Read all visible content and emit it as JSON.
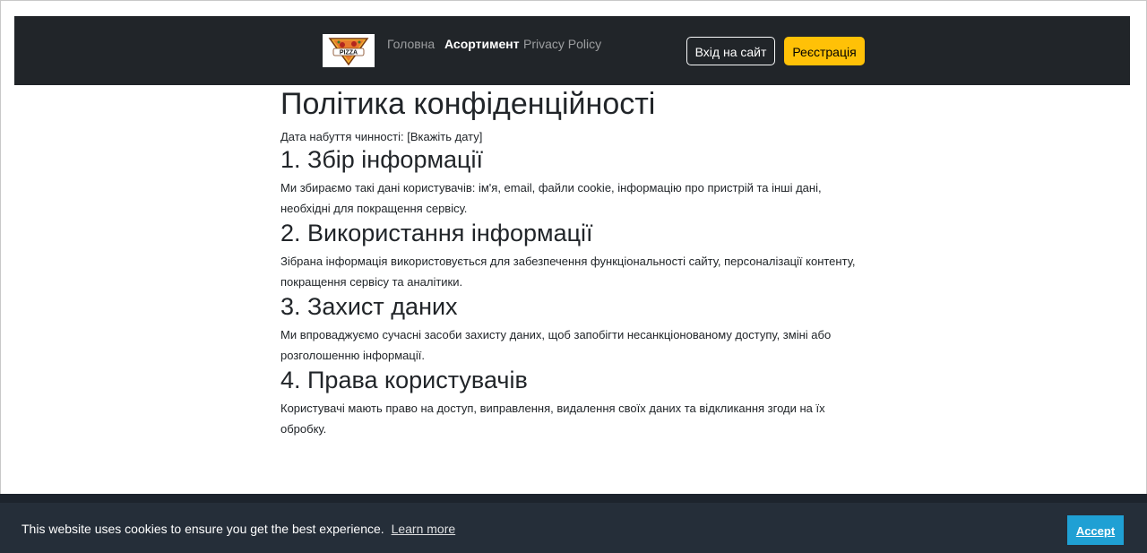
{
  "header": {
    "logo_text": "PIZZA",
    "nav": {
      "home": "Головна",
      "assortment": "Асортимент",
      "privacy": "Privacy Policy"
    },
    "login_label": "Вхід на сайт",
    "register_label": "Реєстрація"
  },
  "main": {
    "title": "Політика конфіденційності",
    "effective_date": "Дата набуття чинності: [Вкажіть дату]",
    "sections": [
      {
        "title": "1. Збір інформації",
        "text": "Ми збираємо такі дані користувачів: ім'я, email, файли cookie, інформацію про пристрій та інші дані, необхідні для покращення сервісу."
      },
      {
        "title": "2. Використання інформації",
        "text": "Зібрана інформація використовується для забезпечення функціональності сайту, персоналізації контенту, покращення сервісу та аналітики."
      },
      {
        "title": "3. Захист даних",
        "text": "Ми впроваджуємо сучасні засоби захисту даних, щоб запобігти несанкціонованому доступу, зміні або розголошенню інформації."
      },
      {
        "title": "4. Права користувачів",
        "text": "Користувачі мають право на доступ, виправлення, видалення своїх даних та відкликання згоди на їх обробку."
      }
    ]
  },
  "cookie_banner": {
    "message": "This website uses cookies to ensure you get the best experience.",
    "learn_more": "Learn more",
    "accept": "Accept"
  },
  "colors": {
    "navbar_bg": "#212529",
    "register_bg": "#ffc107",
    "cookie_bg": "#252e39",
    "accept_bg": "#1fa0d4"
  },
  "icons": {
    "logo": "pizza-logo-icon"
  }
}
